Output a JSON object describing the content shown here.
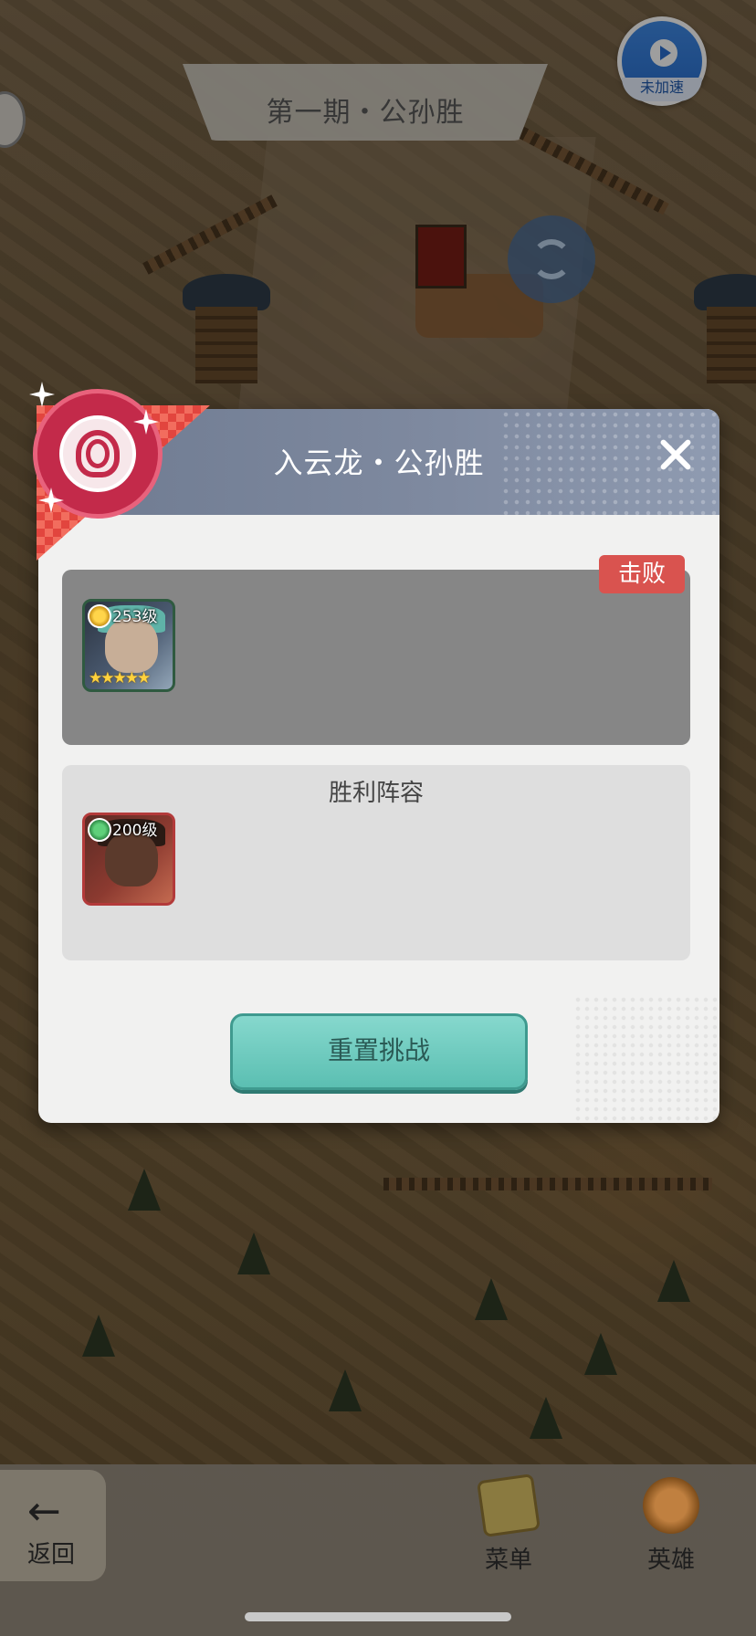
{
  "stage": {
    "title": "第一期・公孙胜"
  },
  "speed_button": {
    "label": "未加速"
  },
  "dialog": {
    "title": "入云龙・公孙胜",
    "enemy": {
      "status_badge": "击败",
      "hero": {
        "level": "253级",
        "stars": "★★★★★",
        "rank": "gold-rank-icon"
      }
    },
    "victory": {
      "label": "胜利阵容",
      "hero": {
        "level": "200级",
        "rank": "green-rank-icon"
      }
    },
    "reset_button": "重置挑战"
  },
  "bottom_nav": {
    "back": {
      "arrow": "←",
      "label": "返回"
    },
    "menu": {
      "label": "菜单"
    },
    "hero": {
      "label": "英雄"
    }
  },
  "colors": {
    "header": "#7f8aa0",
    "defeat_badge": "#d9534f",
    "reset_button": "#6cc8bc",
    "emblem": "#c32a4a"
  }
}
